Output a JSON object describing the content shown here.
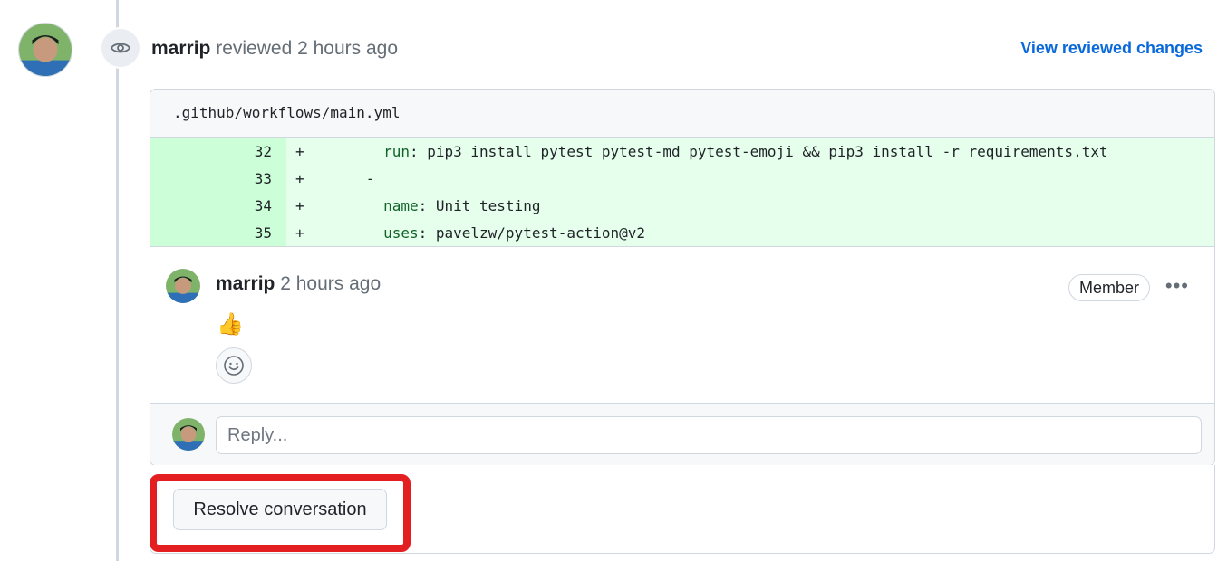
{
  "review": {
    "author": "marrip",
    "action": "reviewed",
    "time": "2 hours ago",
    "view_changes_label": "View reviewed changes"
  },
  "file": {
    "path": ".github/workflows/main.yml",
    "lines": [
      {
        "num": "32",
        "sign": "+",
        "indent": "        ",
        "key": "run",
        "sep": ": ",
        "value": "pip3 install pytest pytest-md pytest-emoji && pip3 install -r requirements.txt"
      },
      {
        "num": "33",
        "sign": "+",
        "indent": "      ",
        "key": "",
        "sep": "",
        "value": "-"
      },
      {
        "num": "34",
        "sign": "+",
        "indent": "        ",
        "key": "name",
        "sep": ": ",
        "value": "Unit testing"
      },
      {
        "num": "35",
        "sign": "+",
        "indent": "        ",
        "key": "uses",
        "sep": ": ",
        "value": "pavelzw/pytest-action@v2"
      }
    ]
  },
  "comment": {
    "author": "marrip",
    "time": "2 hours ago",
    "badge": "Member",
    "more_label": "•••",
    "body_emoji": "👍",
    "reaction_icon": "smiley-icon"
  },
  "reply": {
    "placeholder": "Reply..."
  },
  "resolve": {
    "label": "Resolve conversation"
  },
  "colors": {
    "link": "#0969da",
    "diff_add_num": "#ccffd8",
    "diff_add_code": "#e6ffec",
    "highlight": "#e41f22"
  }
}
